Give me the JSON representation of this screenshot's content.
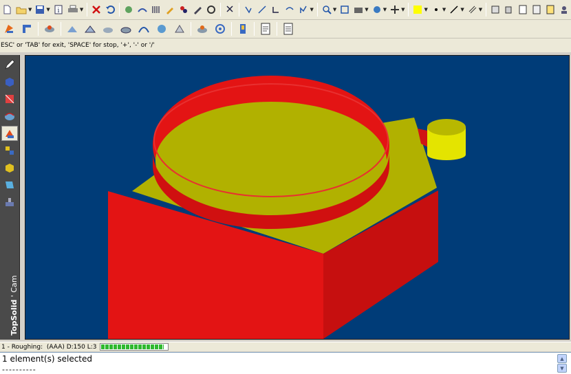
{
  "toolbar1": {
    "icons": [
      "new-file-icon",
      "open-folder-icon",
      "save-icon",
      "info-icon",
      "print-icon",
      "delete-icon",
      "undo-icon",
      "refresh-icon",
      "sweep-icon",
      "ruler-icon",
      "brush-icon",
      "paint-icon",
      "edit-icon",
      "settings-icon",
      "select-icon",
      "snap-icon",
      "measure-icon",
      "hook-icon",
      "check-tool-icon",
      "zoom-icon",
      "fit-icon",
      "camera-icon",
      "rotate-icon",
      "pan-icon",
      "color-swatch-icon",
      "dot-icon",
      "line-icon",
      "hatch-icon",
      "layer-icon",
      "copy-icon",
      "doc-icon",
      "doc2-icon",
      "help-icon",
      "user-icon"
    ]
  },
  "toolbar2": {
    "icons": [
      "part-icon",
      "cut-icon",
      "mill-op-icon",
      "contour-icon",
      "pocket-icon",
      "drill-icon",
      "face-icon",
      "tool-path-icon",
      "ball-icon",
      "wheel-icon",
      "gear-icon",
      "circle-icon",
      "tool-holder-icon",
      "nc-file-icon",
      "nc-report-icon"
    ]
  },
  "hint_text": "ESC' or 'TAB' for exit, 'SPACE' for stop, '+', '-' or '/'",
  "sidebar": {
    "icons": [
      "pencil-icon",
      "solid-icon",
      "sketch-icon",
      "surface-icon",
      "cam-icon",
      "assembly-icon",
      "draft-icon",
      "sheet-icon",
      "machine-icon"
    ],
    "active_index": 4,
    "brand_bold": "TopSolid",
    "brand_sep": "'",
    "brand_rest": "Cam"
  },
  "status": {
    "operation": "1 - Roughing:",
    "details": "(AAA) D:150 L:3",
    "progress": 0.95
  },
  "messages": {
    "line1": "1 element(s) selected",
    "line2": "----------"
  },
  "colors": {
    "viewport_bg": "#003c78",
    "red": "#e31414",
    "yellow": "#b1b100"
  }
}
